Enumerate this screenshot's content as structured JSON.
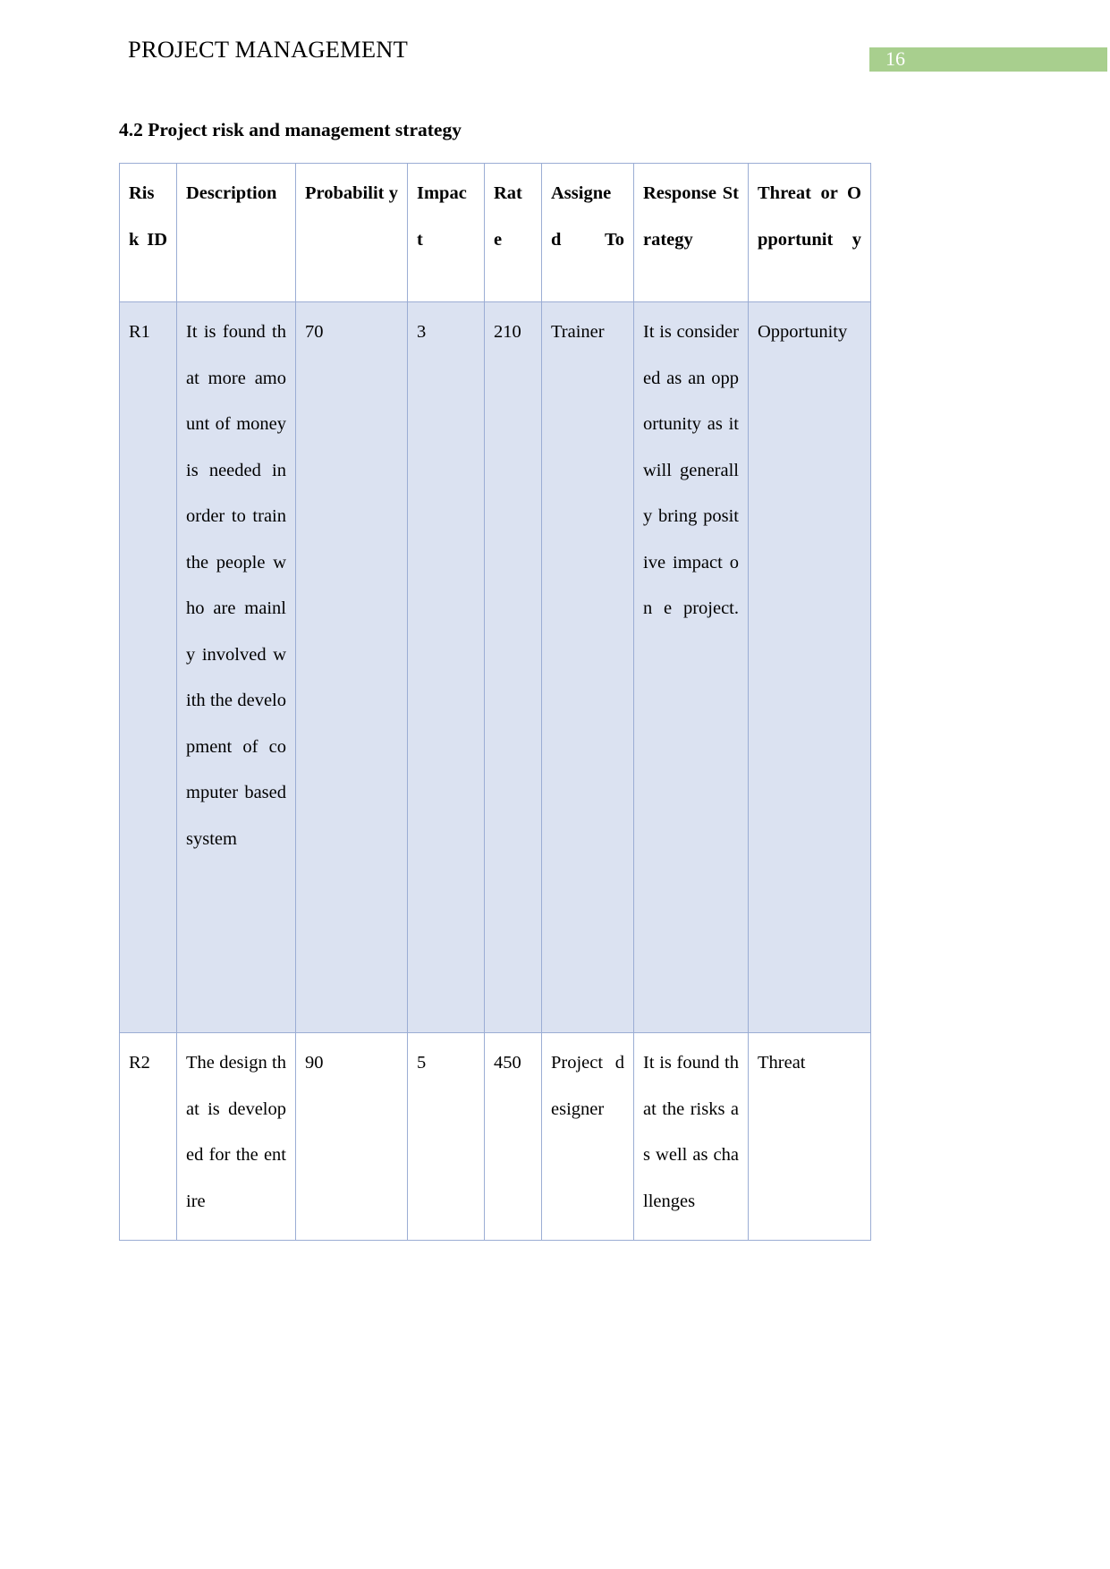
{
  "header": {
    "title": "PROJECT MANAGEMENT",
    "page_number": "16",
    "badge_color": "#a8cf8e"
  },
  "section": {
    "heading": "4.2 Project risk and management strategy"
  },
  "table": {
    "row_shade_color": "#dbe2f1",
    "border_color": "#9badd4",
    "columns": [
      {
        "key": "risk_id",
        "label": "Ris k ID"
      },
      {
        "key": "description",
        "label": "Description"
      },
      {
        "key": "probability",
        "label": "Probabilit y"
      },
      {
        "key": "impact",
        "label": "Impac t"
      },
      {
        "key": "rate",
        "label": "Rat e"
      },
      {
        "key": "assigned_to",
        "label": "Assigne d To"
      },
      {
        "key": "response_strategy",
        "label": "Response Strategy"
      },
      {
        "key": "threat_or_opportunity",
        "label": "Threat or Opportunit y"
      }
    ],
    "rows": [
      {
        "risk_id": "R1",
        "description": "It is found that more amount of money is needed in order to train the people who are mainly involved with the development of computer based system",
        "probability": "70",
        "impact": "3",
        "rate": "210",
        "assigned_to": "Trainer",
        "response_strategy": "It is considered as an opportunity as it will generally bring positive impact on e project.",
        "threat_or_opportunity": "Opportunity"
      },
      {
        "risk_id": "R2",
        "description": "The design that is developed for the entire",
        "probability": "90",
        "impact": "5",
        "rate": "450",
        "assigned_to": "Project designer",
        "response_strategy": "It is found that the risks as well as challenges",
        "threat_or_opportunity": "Threat"
      }
    ]
  }
}
